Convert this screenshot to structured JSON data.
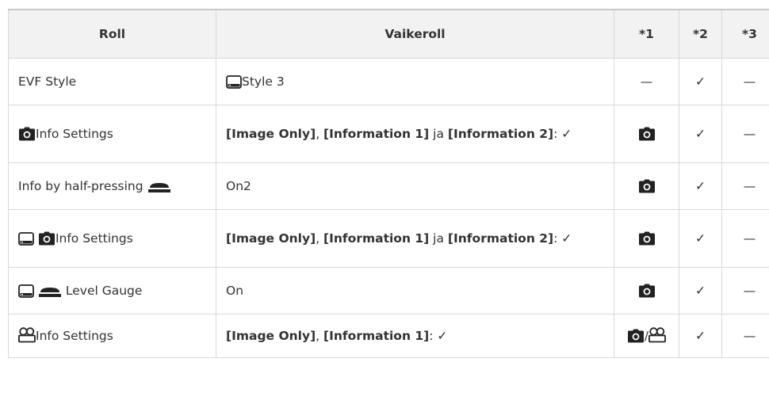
{
  "table": {
    "headers": {
      "col1": "Roll",
      "col2": "Vaikeroll",
      "col3": "*1",
      "col4": "*2",
      "col5": "*3"
    },
    "rows": [
      {
        "setting": "EVF Style",
        "value": "Style 3",
        "c1": "—",
        "c2": "✓",
        "c3": "—"
      },
      {
        "setting": "Info Settings",
        "value_parts": [
          "[Image Only]",
          ", ",
          "[Information 1]",
          " ja ",
          "[Information 2]",
          ": ✓"
        ],
        "c1_icon": "camera-icon",
        "c2": "✓",
        "c3": "—"
      },
      {
        "setting": "Info by half-pressing",
        "value": "On2",
        "c1_icon": "camera-icon",
        "c2": "✓",
        "c3": "—"
      },
      {
        "setting": "Info Settings",
        "value_parts": [
          "[Image Only]",
          ", ",
          "[Information 1]",
          " ja ",
          "[Information 2]",
          ": ✓"
        ],
        "c1_icon": "camera-icon",
        "c2": "✓",
        "c3": "—"
      },
      {
        "setting": "Level Gauge",
        "value": "On",
        "c1_icon": "camera-icon",
        "c2": "✓",
        "c3": "—"
      },
      {
        "setting": "Info Settings",
        "value_parts": [
          "[Image Only]",
          ", ",
          "[Information 1]",
          ": ✓"
        ],
        "c1_sep": "/",
        "c2": "✓",
        "c3": "—"
      }
    ]
  },
  "icons": {
    "viewfinder": "viewfinder-icon",
    "camera": "camera-icon",
    "shutter": "shutter-button-icon",
    "movie": "movie-icon"
  }
}
